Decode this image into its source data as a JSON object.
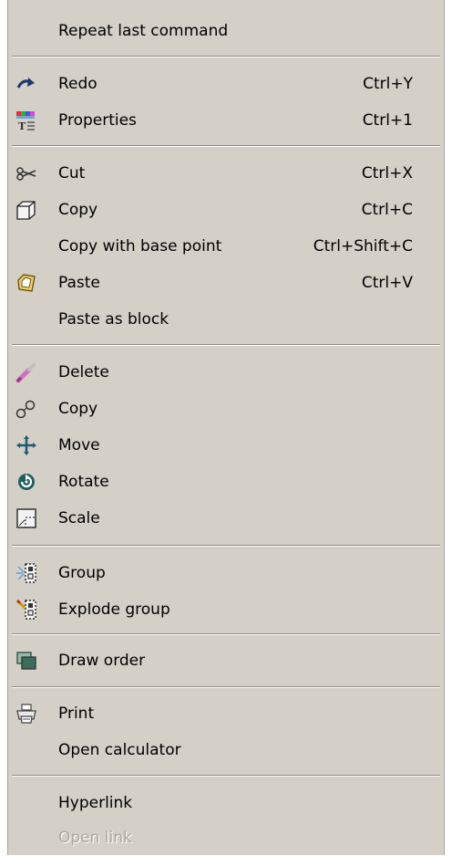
{
  "menu": {
    "items": [
      {
        "label": "Repeat last command",
        "shortcut": ""
      },
      {
        "label": "Redo",
        "shortcut": "Ctrl+Y"
      },
      {
        "label": "Properties",
        "shortcut": "Ctrl+1"
      },
      {
        "label": "Cut",
        "shortcut": "Ctrl+X"
      },
      {
        "label": "Copy",
        "shortcut": "Ctrl+C"
      },
      {
        "label": "Copy with base point",
        "shortcut": "Ctrl+Shift+C"
      },
      {
        "label": "Paste",
        "shortcut": "Ctrl+V"
      },
      {
        "label": "Paste as block",
        "shortcut": ""
      },
      {
        "label": "Delete",
        "shortcut": ""
      },
      {
        "label": "Copy",
        "shortcut": ""
      },
      {
        "label": "Move",
        "shortcut": ""
      },
      {
        "label": "Rotate",
        "shortcut": ""
      },
      {
        "label": "Scale",
        "shortcut": ""
      },
      {
        "label": "Group",
        "shortcut": ""
      },
      {
        "label": "Explode group",
        "shortcut": ""
      },
      {
        "label": "Draw order",
        "shortcut": ""
      },
      {
        "label": "Print",
        "shortcut": ""
      },
      {
        "label": "Open calculator",
        "shortcut": ""
      },
      {
        "label": "Hyperlink",
        "shortcut": ""
      },
      {
        "label": "Open link",
        "shortcut": ""
      }
    ]
  },
  "colors": {
    "menu_background": "#d4d0c8",
    "disabled_text": "#ada99f"
  }
}
